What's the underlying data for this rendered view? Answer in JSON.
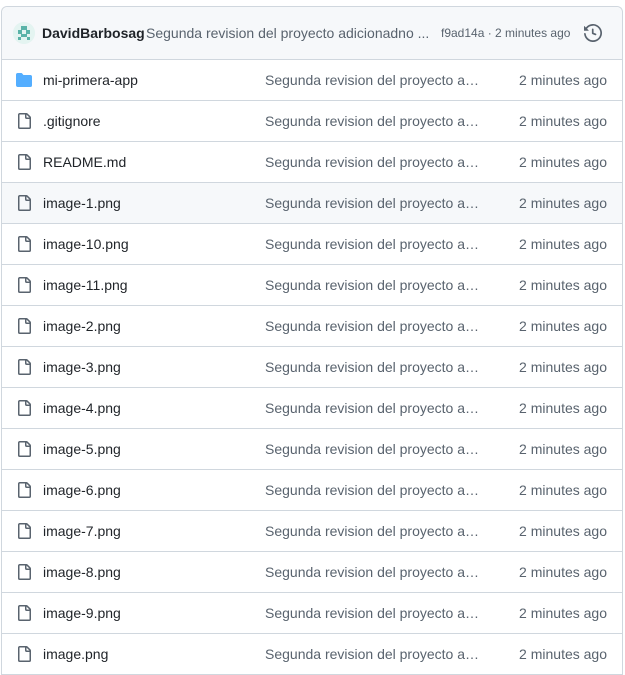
{
  "commit": {
    "author": "DavidBarbosag",
    "message": "Segunda revision del proyecto adicionadno ...",
    "meta": "f9ad14a · 2 minutes ago",
    "history_icon": "history-icon",
    "avatar_icon": "avatar-icon"
  },
  "files": [
    {
      "name": "mi-primera-app",
      "type": "folder",
      "message": "Segunda revision del proyecto adi...",
      "date": "2 minutes ago"
    },
    {
      "name": ".gitignore",
      "type": "file",
      "message": "Segunda revision del proyecto adi...",
      "date": "2 minutes ago"
    },
    {
      "name": "README.md",
      "type": "file",
      "message": "Segunda revision del proyecto adi...",
      "date": "2 minutes ago"
    },
    {
      "name": "image-1.png",
      "type": "file",
      "message": "Segunda revision del proyecto adi...",
      "date": "2 minutes ago",
      "highlighted": true
    },
    {
      "name": "image-10.png",
      "type": "file",
      "message": "Segunda revision del proyecto adi...",
      "date": "2 minutes ago"
    },
    {
      "name": "image-11.png",
      "type": "file",
      "message": "Segunda revision del proyecto adi...",
      "date": "2 minutes ago"
    },
    {
      "name": "image-2.png",
      "type": "file",
      "message": "Segunda revision del proyecto adi...",
      "date": "2 minutes ago"
    },
    {
      "name": "image-3.png",
      "type": "file",
      "message": "Segunda revision del proyecto adi...",
      "date": "2 minutes ago"
    },
    {
      "name": "image-4.png",
      "type": "file",
      "message": "Segunda revision del proyecto adi...",
      "date": "2 minutes ago"
    },
    {
      "name": "image-5.png",
      "type": "file",
      "message": "Segunda revision del proyecto adi...",
      "date": "2 minutes ago"
    },
    {
      "name": "image-6.png",
      "type": "file",
      "message": "Segunda revision del proyecto adi...",
      "date": "2 minutes ago"
    },
    {
      "name": "image-7.png",
      "type": "file",
      "message": "Segunda revision del proyecto adi...",
      "date": "2 minutes ago"
    },
    {
      "name": "image-8.png",
      "type": "file",
      "message": "Segunda revision del proyecto adi...",
      "date": "2 minutes ago"
    },
    {
      "name": "image-9.png",
      "type": "file",
      "message": "Segunda revision del proyecto adi...",
      "date": "2 minutes ago"
    },
    {
      "name": "image.png",
      "type": "file",
      "message": "Segunda revision del proyecto adi...",
      "date": "2 minutes ago"
    }
  ],
  "colors": {
    "folder": "#54aeff",
    "file_icon": "#59636e",
    "border": "#d0d7de",
    "header_bg": "#f6f8fa",
    "muted_text": "#59636e"
  }
}
